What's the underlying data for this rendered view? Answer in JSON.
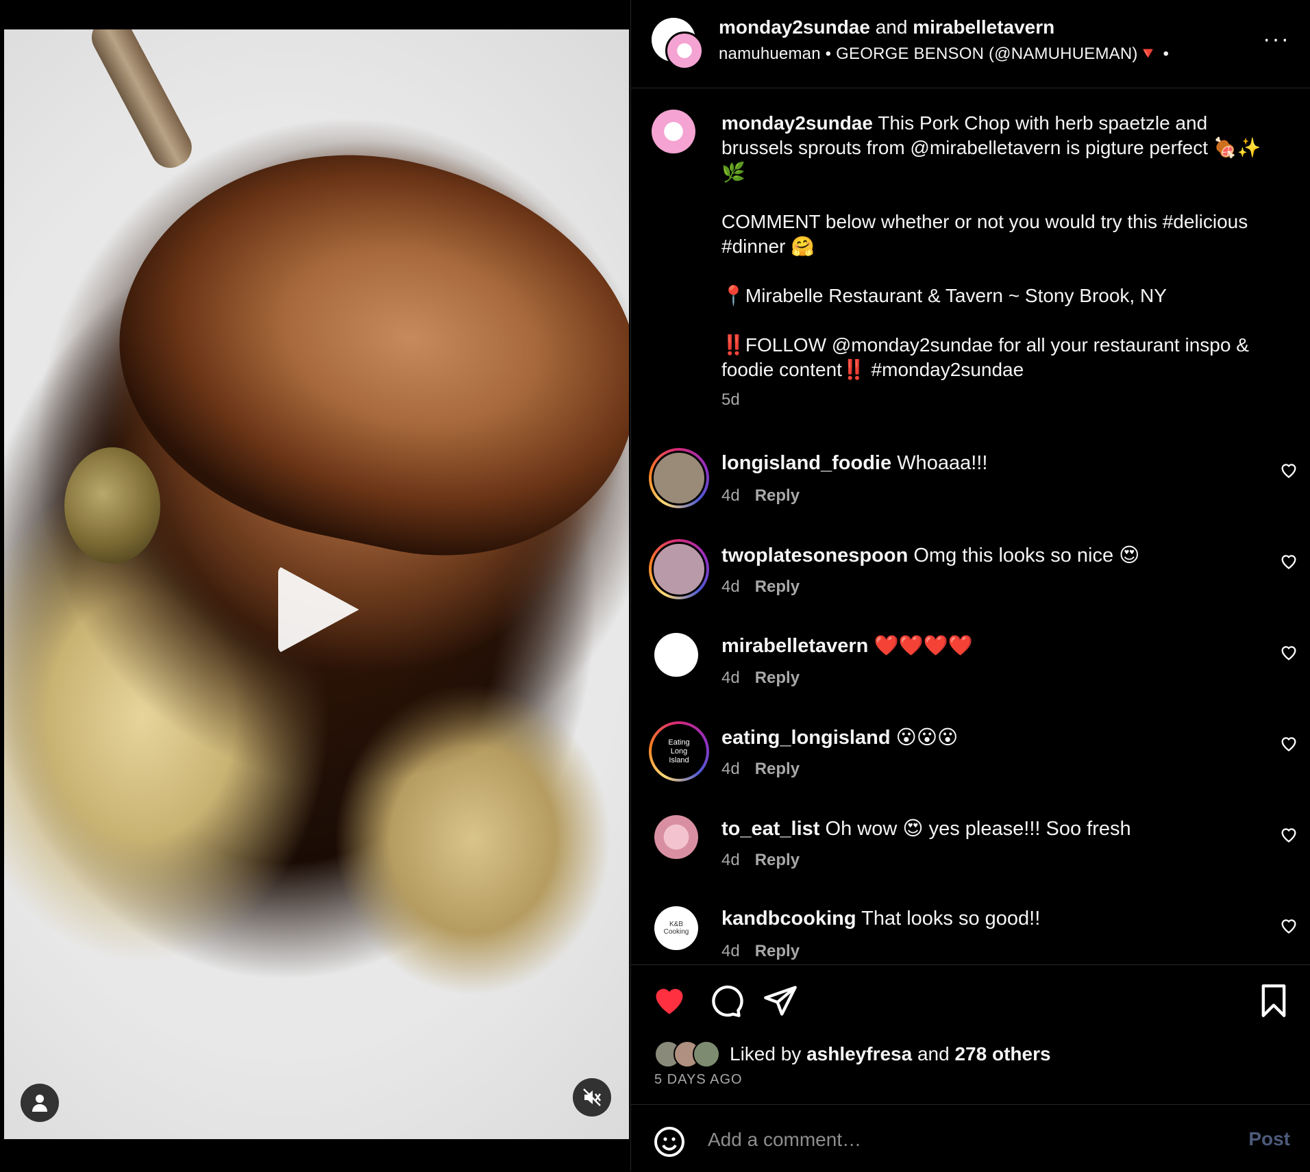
{
  "header": {
    "user1": "monday2sundae",
    "joiner": "and",
    "user2": "mirabelletavern",
    "audio_user": "namuhueman",
    "separator": "•",
    "audio_title": "GEORGE BENSON (@NAMUHUEMAN)🔻",
    "trailing_dot": "•",
    "more": "···"
  },
  "caption": {
    "username": "monday2sundae",
    "text": " This Pork Chop with herb spaetzle and brussels sprouts from @mirabelletavern is pigture perfect 🍖✨🌿\n\nCOMMENT below whether or not you would try this #delicious #dinner 🤗\n\n📍Mirabelle Restaurant & Tavern ~ Stony Brook, NY\n\n‼️FOLLOW @monday2sundae for all your restaurant inspo & foodie content‼️ #monday2sundae",
    "time": "5d"
  },
  "comments": [
    {
      "user": "longisland_foodie",
      "text": "Whoaaa!!!",
      "time": "4d",
      "reply": "Reply"
    },
    {
      "user": "twoplatesonespoon",
      "text": "Omg this looks so nice 😍",
      "time": "4d",
      "reply": "Reply"
    },
    {
      "user": "mirabelletavern",
      "text": "❤️❤️❤️❤️",
      "time": "4d",
      "reply": "Reply"
    },
    {
      "user": "eating_longisland",
      "text": "😮😮😮",
      "time": "4d",
      "reply": "Reply"
    },
    {
      "user": "to_eat_list",
      "text": "Oh wow 😍 yes please!!! Soo fresh",
      "time": "4d",
      "reply": "Reply"
    },
    {
      "user": "kandbcooking",
      "text": "That looks so good!!",
      "time": "4d",
      "reply": "Reply"
    }
  ],
  "avatar_labels": {
    "eating_longisland": "Eating Long Island",
    "kandbcooking": "K&B Cooking"
  },
  "likes": {
    "prefix": "Liked by",
    "user": "ashleyfresa",
    "joiner": "and",
    "others": "278 others"
  },
  "date": "5 DAYS AGO",
  "add_comment": {
    "placeholder": "Add a comment…",
    "post": "Post"
  },
  "colors": {
    "like_red": "#ff3040",
    "muted_text": "#a8a8a8",
    "post_disabled": "#4c5a7a"
  },
  "icons": [
    "play-icon",
    "user-tag-icon",
    "mute-icon",
    "more-icon",
    "heart-icon",
    "comment-icon",
    "share-icon",
    "bookmark-icon",
    "emoji-icon"
  ]
}
